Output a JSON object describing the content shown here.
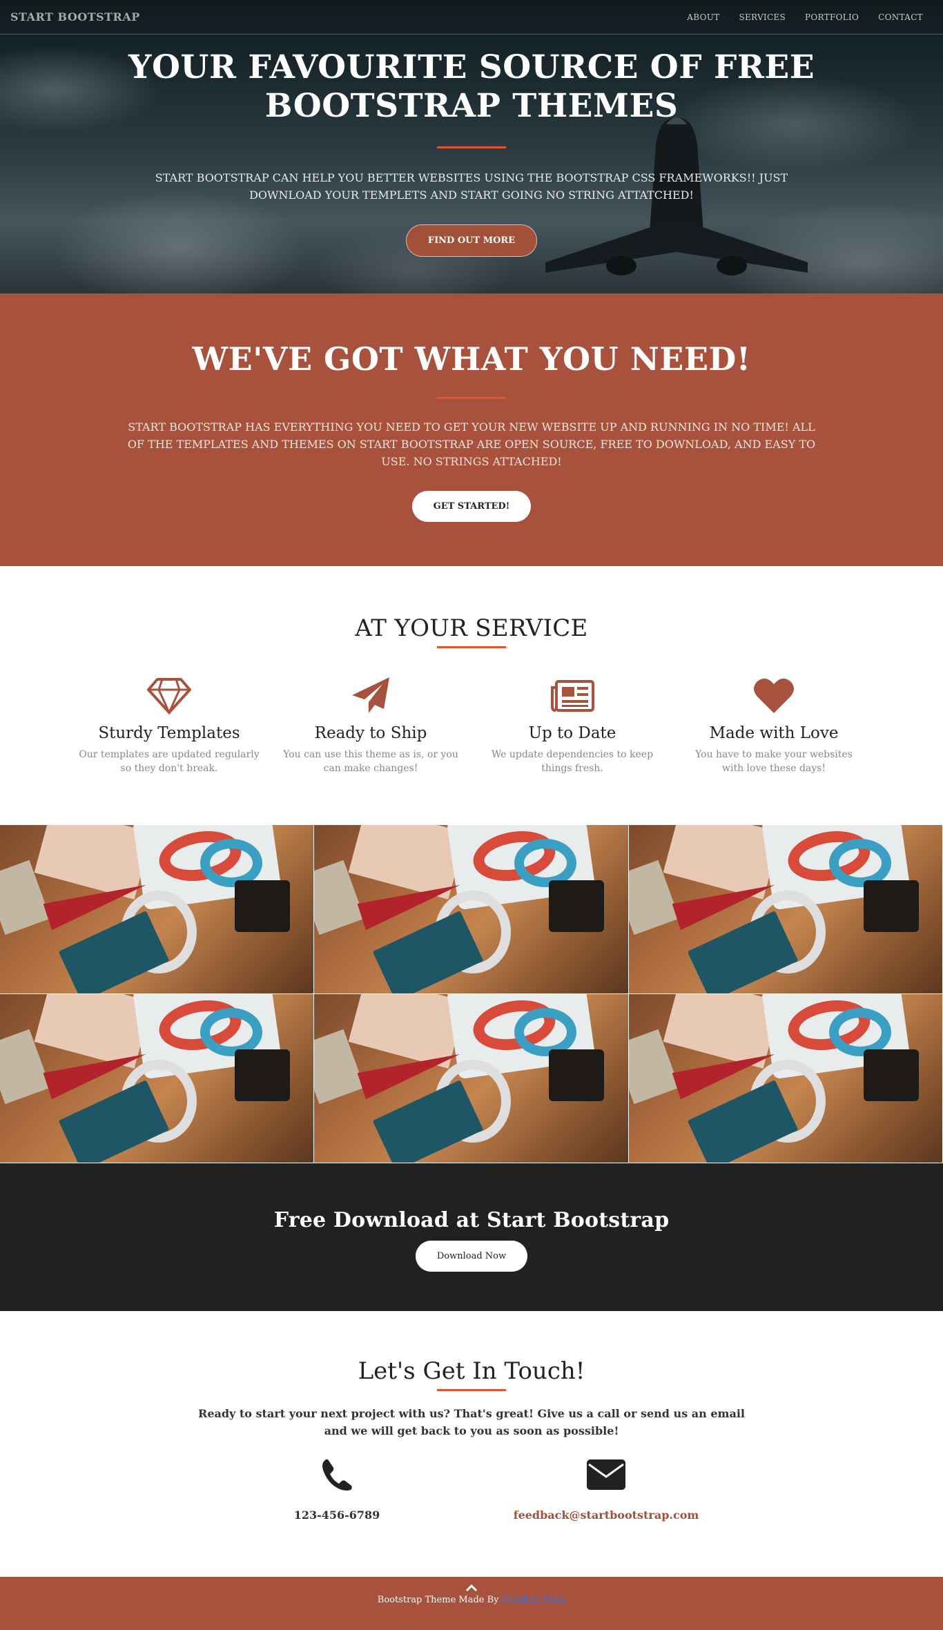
{
  "nav": {
    "brand": "START BOOTSTRAP",
    "links": [
      "ABOUT",
      "SERVICES",
      "PORTFOLIO",
      "CONTACT"
    ]
  },
  "hero": {
    "title_line1": "YOUR FAVOURITE SOURCE OF FREE",
    "title_line2": "BOOTSTRAP THEMES",
    "text": "START BOOTSTRAP CAN HELP YOU BETTER WEBSITES USING THE BOOTSTRAP CSS FRAMEWORKS!! JUST DOWNLOAD YOUR TEMPLETS AND START GOING NO STRING ATTATCHED!",
    "button": "FIND OUT MORE"
  },
  "about": {
    "title": "WE'VE GOT WHAT YOU NEED!",
    "text": "START BOOTSTRAP HAS EVERYTHING YOU NEED TO GET YOUR NEW WEBSITE UP AND RUNNING IN NO TIME! ALL OF THE TEMPLATES AND THEMES ON START BOOTSTRAP ARE OPEN SOURCE, FREE TO DOWNLOAD, AND EASY TO USE. NO STRINGS ATTACHED!",
    "button": "GET STARTED!"
  },
  "services": {
    "title": "AT YOUR SERVICE",
    "items": [
      {
        "icon": "diamond-icon",
        "title": "Sturdy Templates",
        "text": "Our templates are updated regularly so they don't break."
      },
      {
        "icon": "paper-plane-icon",
        "title": "Ready to Ship",
        "text": "You can use this theme as is, or you can make changes!"
      },
      {
        "icon": "newspaper-icon",
        "title": "Up to Date",
        "text": "We update dependencies to keep things fresh."
      },
      {
        "icon": "heart-icon",
        "title": "Made with Love",
        "text": "You have to make your websites with love these days!"
      }
    ]
  },
  "download": {
    "title": "Free Download at Start Bootstrap",
    "button": "Download Now"
  },
  "contact": {
    "title": "Let's Get In Touch!",
    "text": "Ready to start your next project with us? That's great! Give us a call or send us an email and we will get back to you as soon as possible!",
    "phone": "123-456-6789",
    "email": "feedback@startbootstrap.com"
  },
  "footer": {
    "credit_prefix": "Bootstrap Theme Made By",
    "credit_author": "Mohitha Shah"
  },
  "colors": {
    "accent": "#a8523d",
    "rule": "#e0542e",
    "dark": "#212121"
  }
}
